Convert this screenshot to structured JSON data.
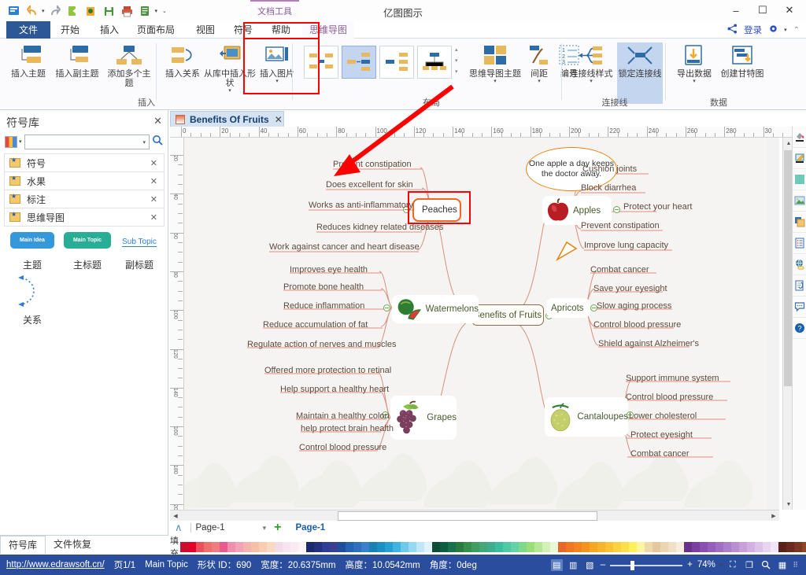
{
  "window": {
    "app_title": "亿图图示",
    "doc_tool_tab": "文档工具",
    "minimize": "–",
    "maximize": "☐",
    "close": "✕"
  },
  "quick_access": [
    {
      "name": "edraw-logo-icon",
      "glyph": "☰"
    },
    {
      "name": "undo-icon",
      "glyph": "↶"
    },
    {
      "name": "redo-icon",
      "glyph": "↷"
    },
    {
      "name": "new-file-icon",
      "glyph": "➕"
    },
    {
      "name": "open-file-icon",
      "glyph": "Ὄ2"
    },
    {
      "name": "save-icon",
      "glyph": "ὋE"
    },
    {
      "name": "print-icon",
      "glyph": "⎙"
    },
    {
      "name": "preview-icon",
      "glyph": "☰"
    }
  ],
  "ribbon_tabs": [
    {
      "label": "文件",
      "type": "file"
    },
    {
      "label": "开始",
      "type": "normal"
    },
    {
      "label": "插入",
      "type": "normal"
    },
    {
      "label": "页面布局",
      "type": "normal"
    },
    {
      "label": "视图",
      "type": "normal"
    },
    {
      "label": "符号",
      "type": "normal"
    },
    {
      "label": "帮助",
      "type": "normal"
    },
    {
      "label": "思维导图",
      "type": "active"
    }
  ],
  "title_actions": {
    "share_label": "share-icon",
    "login_label": "登录",
    "settings_label": "gear-icon",
    "collapse_label": "collapse-ribbon-icon"
  },
  "ribbon_groups": [
    {
      "name": "insert",
      "label": "插入",
      "buttons": [
        {
          "label": "插入主题",
          "icon": "insert-topic-icon",
          "dropdown": false
        },
        {
          "label": "插入副主题",
          "icon": "insert-subtopic-icon",
          "dropdown": false
        },
        {
          "label": "添加多个主题",
          "icon": "add-multi-topic-icon",
          "dropdown": false
        },
        {
          "label": "插入关系",
          "icon": "insert-relation-icon",
          "dropdown": false
        },
        {
          "label": "从库中插入形状",
          "icon": "insert-shape-from-library-icon",
          "dropdown": true
        },
        {
          "label": "插入图片",
          "icon": "insert-picture-icon",
          "dropdown": true
        }
      ]
    },
    {
      "name": "layout",
      "label": "布局",
      "layout_options": [
        {
          "name": "layout-both-sides",
          "selected": false
        },
        {
          "name": "layout-right-side",
          "selected": true
        },
        {
          "name": "layout-left-side",
          "selected": false
        },
        {
          "name": "layout-org-chart",
          "selected": false
        }
      ],
      "buttons": [
        {
          "label": "思维导图主题",
          "icon": "mindmap-theme-icon",
          "dropdown": true
        },
        {
          "label": "间距",
          "icon": "spacing-icon",
          "dropdown": true
        },
        {
          "label": "编号",
          "icon": "numbering-icon",
          "dropdown": false
        }
      ]
    },
    {
      "name": "connector",
      "label": "连接线",
      "buttons": [
        {
          "label": "连接线样式",
          "icon": "connector-style-icon",
          "dropdown": true
        },
        {
          "label": "锁定连接线",
          "icon": "lock-connector-icon",
          "dropdown": false,
          "toggled": true
        }
      ]
    },
    {
      "name": "data",
      "label": "数据",
      "buttons": [
        {
          "label": "导出数据",
          "icon": "export-data-icon",
          "dropdown": true
        },
        {
          "label": "创建甘特图",
          "icon": "create-gantt-icon",
          "dropdown": false
        }
      ]
    }
  ],
  "left_panel": {
    "title": "符号库",
    "close": "✕",
    "search_placeholder": "",
    "libraries": [
      {
        "label": "符号"
      },
      {
        "label": "水果"
      },
      {
        "label": "标注"
      },
      {
        "label": "思维导图"
      }
    ],
    "shapes": [
      {
        "pill_text": "Main Idea",
        "caption": "主题",
        "color": "#3498db"
      },
      {
        "pill_text": "Main Topic",
        "caption": "主标题",
        "color": "#27ae94"
      },
      {
        "pill_text": "Sub Topic",
        "caption": "副标题",
        "color": "#2b7fd4"
      },
      {
        "pill_text": "",
        "caption": "关系",
        "color": "#2b7fd4"
      }
    ],
    "footer_tabs": [
      {
        "label": "符号库",
        "active": true
      },
      {
        "label": "文件恢复",
        "active": false
      }
    ]
  },
  "document_tab": {
    "title": "Benefits Of Fruits",
    "close": "✕"
  },
  "rulers": {
    "horizontal_labels": [
      "0",
      "20",
      "40",
      "60",
      "80",
      "100",
      "120",
      "140",
      "160",
      "180",
      "200",
      "220",
      "240",
      "260",
      "280",
      "30"
    ],
    "vertical_labels": [
      "20",
      "40",
      "60",
      "80",
      "100",
      "120",
      "140",
      "160",
      "180",
      "200"
    ]
  },
  "mindmap": {
    "root": "Benefits of Fruits",
    "callout": "One apple a day keeps the doctor away.",
    "branches": [
      {
        "name": "Peaches",
        "side": "left",
        "icon": "peach-icon",
        "selected": true,
        "children": [
          "Prevent constipation",
          "Does excellent for skin",
          "Works as anti-inflammatory",
          "Reduces kidney related diseases",
          "Work against cancer and heart disease"
        ]
      },
      {
        "name": "Apples",
        "side": "right",
        "icon": "apple-icon",
        "children": [
          "Cushion joints",
          "Block diarrhea",
          "Protect your heart",
          "Prevent constipation",
          "Improve lung capacity"
        ]
      },
      {
        "name": "Watermelons",
        "side": "left",
        "icon": "watermelon-icon",
        "children": [
          "Improves eye health",
          "Promote bone health",
          "Reduce inflammation",
          "Reduce accumulation of fat",
          "Regulate action of nerves and muscles"
        ]
      },
      {
        "name": "Apricots",
        "side": "right",
        "icon": "apricot-icon",
        "children": [
          "Combat cancer",
          "Save your eyesight",
          "Slow aging process",
          "Control blood pressure",
          "Shield against Alzheimer's"
        ]
      },
      {
        "name": "Grapes",
        "side": "left",
        "icon": "grapes-icon",
        "children": [
          "Offered more protection to retinal",
          "Help support a healthy heart",
          "Maintain a healthy colon",
          "help protect brain health",
          "Control blood pressure"
        ]
      },
      {
        "name": "Cantaloupes",
        "side": "right",
        "icon": "cantaloupe-icon",
        "children": [
          "Support immune system",
          "Control blood pressure",
          "Lower cholesterol",
          "Protect eyesight",
          "Combat cancer"
        ]
      }
    ]
  },
  "page_nav": {
    "collapse": "∧",
    "current_page": "Page-1",
    "dropdown": "▾",
    "add": "+",
    "tab_label": "Page-1"
  },
  "fill_bar": {
    "label": "填充",
    "swatches": [
      "#c8102e",
      "#e4002b",
      "#e8505b",
      "#ef6f6c",
      "#f07d7d",
      "#e85a8e",
      "#ef8fb0",
      "#f2a3b8",
      "#f4b2b0",
      "#f6bfa8",
      "#f8cdb0",
      "#fad9c2",
      "#f2dce8",
      "#f6e4ef",
      "#faeaf2",
      "#fdf2f6",
      "#1b2a6b",
      "#25307e",
      "#2f3d96",
      "#3a3f8f",
      "#1f4e9c",
      "#2463af",
      "#2f6fc0",
      "#3a7fcc",
      "#1a7fb5",
      "#1a8fc4",
      "#26a0d4",
      "#3fb4e0",
      "#6ec9ea",
      "#95d8f0",
      "#bfe7f7",
      "#dff3fb",
      "#0b4d35",
      "#0e5d40",
      "#17714c",
      "#2b7a3e",
      "#388f4a",
      "#3f9c63",
      "#45a878",
      "#3fae8e",
      "#3cbda0",
      "#4dc9a5",
      "#62d2a8",
      "#7fd98a",
      "#9ade77",
      "#b7e697",
      "#d2f0b8",
      "#e8f7d8",
      "#e8662a",
      "#ef7622",
      "#f2851f",
      "#f39422",
      "#f5a623",
      "#f7b32b",
      "#f9c335",
      "#fbd23f",
      "#fde047",
      "#fdf05a",
      "#fdf6a0",
      "#eed9a8",
      "#e4c79c",
      "#e9d5b2",
      "#f0e0c8",
      "#f8eddc",
      "#6b2f8c",
      "#7b3fa0",
      "#8a4fb0",
      "#9460bb",
      "#a06fc4",
      "#ab7fcb",
      "#b98fd2",
      "#c79fda",
      "#d3b0e2",
      "#dfc2ea",
      "#e8d4f0",
      "#f2e4f7",
      "#5a2118",
      "#6b2a1d",
      "#7d3622",
      "#8f4527",
      "#a1552d",
      "#b36734",
      "#c57a3e",
      "#d08f52",
      "#dba56c",
      "#e3bb8c",
      "#d8d8d8",
      "#c8cfc9",
      "#000000",
      "#1f1f1f",
      "#333333",
      "#4a4a4a",
      "#666666",
      "#808080",
      "#999999",
      "#b3b3b3",
      "#c6c6c6",
      "#d9d9d9",
      "#e8e8e8",
      "#f2f2f2",
      "#fafafa",
      "#ffffff",
      "#ffffff",
      "#ffffff",
      "#ffffff",
      "#ffffff"
    ]
  },
  "status_bar": {
    "url": "http://www.edrawsoft.cn/",
    "page": "页1/1",
    "shape_name": "Main Topic",
    "shape_id": "形状 ID：690",
    "width": "宽度：20.6375mm",
    "height": "高度：10.0542mm",
    "angle": "角度：0deg",
    "zoom": "74%",
    "view_buttons": [
      {
        "name": "normal-view-icon",
        "glyph": "▤",
        "active": true
      },
      {
        "name": "split-view-icon",
        "glyph": "▥",
        "active": false
      },
      {
        "name": "full-view-icon",
        "glyph": "▧",
        "active": false
      }
    ],
    "zoom_out": "–",
    "zoom_in": "+",
    "extra_buttons": [
      {
        "name": "fit-selection-icon",
        "glyph": "⛶"
      },
      {
        "name": "fit-page-icon",
        "glyph": "❐"
      },
      {
        "name": "zoom-tool-icon",
        "glyph": "ὐD"
      },
      {
        "name": "grid-icon",
        "glyph": "▦"
      }
    ]
  },
  "right_rail": [
    {
      "name": "fill-tool-icon"
    },
    {
      "name": "pen-tool-icon"
    },
    {
      "name": "color-swatch-icon"
    },
    {
      "name": "image-tool-icon"
    },
    {
      "name": "layers-icon"
    },
    {
      "name": "list-panel-icon"
    },
    {
      "name": "globe-link-icon"
    },
    {
      "name": "attachment-icon"
    },
    {
      "name": "comment-icon"
    },
    {
      "name": "help-icon"
    }
  ]
}
